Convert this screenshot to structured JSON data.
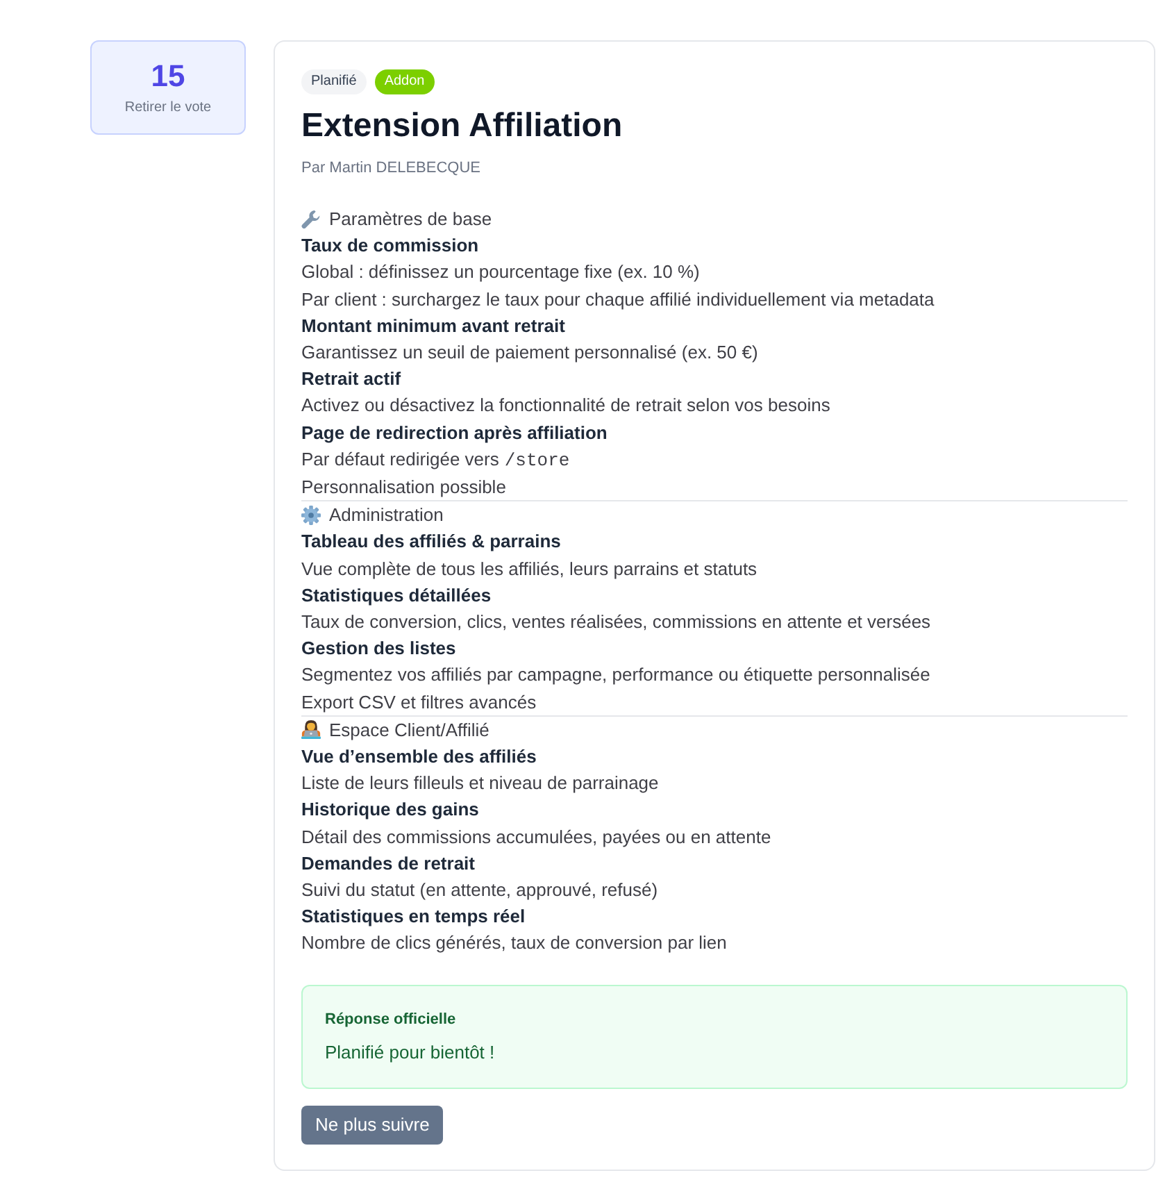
{
  "vote": {
    "count": "15",
    "label": "Retirer le vote",
    "voted": true
  },
  "post": {
    "badges": [
      {
        "text": "Planifié",
        "color": "#f3f4f6"
      },
      {
        "text": "Addon",
        "color": "#7ccf00"
      }
    ],
    "title": "Extension Affiliation",
    "author": "Par Martin DELEBECQUE",
    "sections": [
      {
        "heading": "Paramètres de base",
        "lines": [
          {
            "kind": "label",
            "text": "Taux de commission"
          },
          {
            "kind": "text",
            "text": "Global : définissez un pourcentage fixe (ex. 10 %)"
          },
          {
            "kind": "text",
            "text": "Par client : surchargez le taux pour chaque affilié individuellement via metadata"
          },
          {
            "kind": "label",
            "text": "Montant minimum avant retrait"
          },
          {
            "kind": "text",
            "text": "Garantissez un seuil de paiement personnalisé (ex. 50 €)"
          },
          {
            "kind": "label",
            "text": "Retrait actif"
          },
          {
            "kind": "text",
            "text": "Activez ou désactivez la fonctionnalité de retrait selon vos besoins"
          },
          {
            "kind": "label",
            "text": "Page de redirection après affiliation"
          },
          {
            "kind": "text",
            "text": "Par défaut redirigée vers",
            "code": "/store"
          },
          {
            "kind": "text",
            "text": "Personnalisation possible"
          }
        ]
      },
      {
        "heading": "Administration",
        "lines": [
          {
            "kind": "label",
            "text": "Tableau des affiliés & parrains"
          },
          {
            "kind": "text",
            "text": "Vue complète de tous les affiliés, leurs parrains et statuts"
          },
          {
            "kind": "label",
            "text": "Statistiques détaillées"
          },
          {
            "kind": "text",
            "text": "Taux de conversion, clics, ventes réalisées, commissions en attente et versées"
          },
          {
            "kind": "label",
            "text": "Gestion des listes"
          },
          {
            "kind": "text",
            "text": "Segmentez vos affiliés par campagne, performance ou étiquette personnalisée"
          },
          {
            "kind": "text",
            "text": "Export CSV et filtres avancés"
          }
        ]
      },
      {
        "heading": "Espace Client/Affilié",
        "lines": [
          {
            "kind": "label",
            "text": "Vue d’ensemble des affiliés"
          },
          {
            "kind": "text",
            "text": "Liste de leurs filleuls et niveau de parrainage"
          },
          {
            "kind": "label",
            "text": "Historique des gains"
          },
          {
            "kind": "text",
            "text": "Détail des commissions accumulées, payées ou en attente"
          },
          {
            "kind": "label",
            "text": "Demandes de retrait"
          },
          {
            "kind": "text",
            "text": "Suivi du statut (en attente, approuvé, refusé)"
          },
          {
            "kind": "label",
            "text": "Statistiques en temps réel"
          },
          {
            "kind": "text",
            "text": "Nombre de clics générés, taux de conversion par lien"
          }
        ]
      }
    ],
    "official_response": {
      "label": "Réponse officielle",
      "text": "Planifié pour bientôt !"
    },
    "follow_button": {
      "label": "Ne plus suivre"
    }
  }
}
